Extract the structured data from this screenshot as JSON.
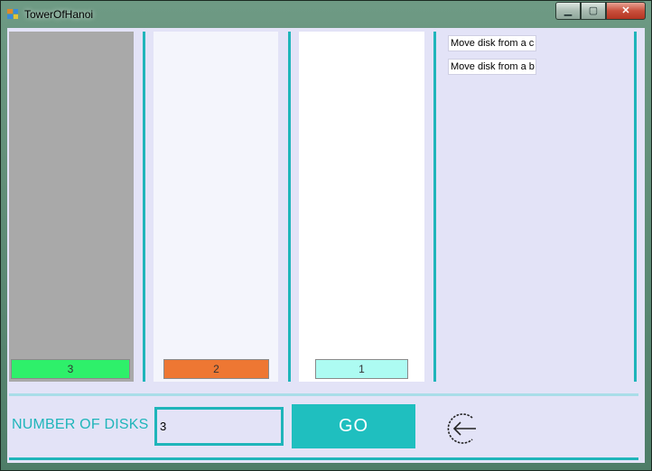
{
  "window": {
    "title": "TowerOfHanoi",
    "controls": {
      "minimize": "▁",
      "maximize": "▢",
      "close": "✕"
    }
  },
  "pegs": {
    "a": {
      "disks": [
        {
          "label": "3",
          "color": "#2ef06a"
        }
      ]
    },
    "b": {
      "disks": [
        {
          "label": "2",
          "color": "#ee7733"
        }
      ]
    },
    "c": {
      "disks": [
        {
          "label": "1",
          "color": "#adfbf2"
        }
      ]
    }
  },
  "moves_log": [
    "Move disk from a c",
    "Move disk from a b"
  ],
  "controls": {
    "number_of_disks_label": "NUMBER OF DISKS",
    "disks_input_value": "3",
    "go_label": "GO",
    "back_icon": "back-arrow-circle-icon"
  },
  "colors": {
    "accent": "#1fb5ba",
    "go_button": "#1fbfbf",
    "panel_bg": "#e3e3f7"
  }
}
